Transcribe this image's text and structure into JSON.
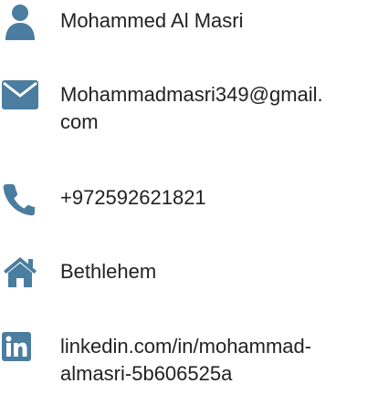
{
  "contact": {
    "name": "Mohammed Al Masri",
    "email_line1": "Mohammadmasri349@gmail.",
    "email_line2": "com",
    "phone": "+972592621821",
    "location": "Bethlehem",
    "linkedin_line1": "linkedin.com/in/mohammad-",
    "linkedin_line2": "almasri-5b606525a"
  },
  "icons": {
    "name": "user-icon",
    "email": "envelope-icon",
    "phone": "phone-icon",
    "location": "home-icon",
    "linkedin": "linkedin-icon"
  },
  "colors": {
    "icon": "#4a7da0",
    "text": "#222222"
  }
}
